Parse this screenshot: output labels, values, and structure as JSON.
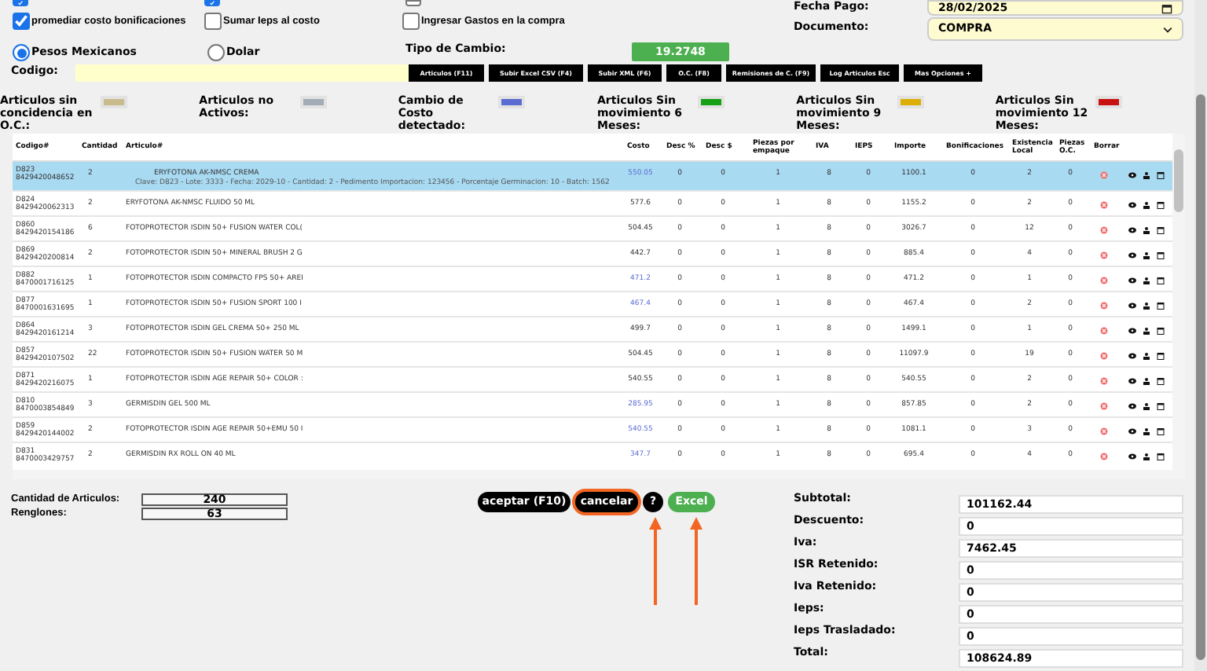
{
  "top_checkboxes": [
    {
      "checked": true
    },
    {
      "checked": true
    },
    {
      "checked": false
    }
  ],
  "fecha_pago": {
    "label": "Fecha Pago:",
    "value": "28/02/2025"
  },
  "options": [
    {
      "label": "promediar costo bonificaciones",
      "checked": true
    },
    {
      "label": "Sumar Ieps al costo",
      "checked": false
    },
    {
      "label": "Ingresar Gastos en la compra",
      "checked": false
    }
  ],
  "documento": {
    "label": "Documento:",
    "value": "COMPRA"
  },
  "currency": [
    {
      "label": "Pesos Mexicanos",
      "selected": true
    },
    {
      "label": "Dolar",
      "selected": false
    }
  ],
  "tipo_cambio": {
    "label": "Tipo de Cambio:",
    "value": "19.2748"
  },
  "codigo": {
    "label": "Codigo:"
  },
  "toolbar": [
    "Articulos (F11)",
    "Subir Excel CSV (F4)",
    "Subir XML (F6)",
    "O.C. (F8)",
    "Remisiones de C. (F9)",
    "Log Articulos Esc",
    "Mas Opciones +"
  ],
  "legend": [
    {
      "label": "Articulos sin concidencia en O.C.:",
      "color": "#c9bc8c"
    },
    {
      "label": "Articulos no Activos:",
      "color": "#a3abb7"
    },
    {
      "label": "Cambio de Costo detectado:",
      "color": "#5a6cd2"
    },
    {
      "label": "Articulos Sin movimiento 6 Meses:",
      "color": "#16a016"
    },
    {
      "label": "Articulos Sin movimiento 9 Meses:",
      "color": "#dcae06"
    },
    {
      "label": "Articulos Sin movimiento 12 Meses:",
      "color": "#c81212"
    }
  ],
  "table": {
    "columns": [
      "Codigo#",
      "Cantidad",
      "Articulo#",
      "Costo",
      "Desc %",
      "Desc $",
      "Piezas por empaque",
      "IVA",
      "IEPS",
      "Importe",
      "Bonificaciones",
      "Existencia Local",
      "Piezas O.C.",
      "Borrar"
    ],
    "rows": [
      {
        "selected": true,
        "cost_changed": true,
        "code": "D823",
        "barcode": "8429420048652",
        "qty": "2",
        "article": "ERYFOTONA AK-NMSC CREMA",
        "detail": "Clave: D823 - Lote: 3333 - Fecha: 2029-10 - Cantidad: 2 - Pedimento Importacion: 123456 - Porcentaje Germinacion: 10 - Batch: 1562",
        "cost": "550.05",
        "desc_pct": "0",
        "desc_amt": "0",
        "pieces": "1",
        "iva": "8",
        "ieps": "0",
        "importe": "1100.1",
        "bonif": "0",
        "stock": "2",
        "pieces_oc": "0"
      },
      {
        "selected": false,
        "cost_changed": false,
        "code": "D824",
        "barcode": "8429420062313",
        "qty": "2",
        "article": "ERYFOTONA AK-NMSC FLUIDO 50 ML",
        "cost": "577.6",
        "desc_pct": "0",
        "desc_amt": "0",
        "pieces": "1",
        "iva": "8",
        "ieps": "0",
        "importe": "1155.2",
        "bonif": "0",
        "stock": "2",
        "pieces_oc": "0"
      },
      {
        "selected": false,
        "cost_changed": false,
        "code": "D860",
        "barcode": "8429420154186",
        "qty": "6",
        "article": "FOTOPROTECTOR ISDIN 50+ FUSION WATER COL(",
        "cost": "504.45",
        "desc_pct": "0",
        "desc_amt": "0",
        "pieces": "1",
        "iva": "8",
        "ieps": "0",
        "importe": "3026.7",
        "bonif": "0",
        "stock": "12",
        "pieces_oc": "0"
      },
      {
        "selected": false,
        "cost_changed": false,
        "code": "D869",
        "barcode": "8429420200814",
        "qty": "2",
        "article": "FOTOPROTECTOR ISDIN 50+ MINERAL BRUSH 2 G",
        "cost": "442.7",
        "desc_pct": "0",
        "desc_amt": "0",
        "pieces": "1",
        "iva": "8",
        "ieps": "0",
        "importe": "885.4",
        "bonif": "0",
        "stock": "4",
        "pieces_oc": "0"
      },
      {
        "selected": false,
        "cost_changed": true,
        "code": "D882",
        "barcode": "8470001716125",
        "qty": "1",
        "article": "FOTOPROTECTOR ISDIN COMPACTO FPS 50+ AREI",
        "cost": "471.2",
        "desc_pct": "0",
        "desc_amt": "0",
        "pieces": "1",
        "iva": "8",
        "ieps": "0",
        "importe": "471.2",
        "bonif": "0",
        "stock": "1",
        "pieces_oc": "0"
      },
      {
        "selected": false,
        "cost_changed": true,
        "code": "D877",
        "barcode": "8470001631695",
        "qty": "1",
        "article": "FOTOPROTECTOR ISDIN 50+ FUSION SPORT 100 I",
        "cost": "467.4",
        "desc_pct": "0",
        "desc_amt": "0",
        "pieces": "1",
        "iva": "8",
        "ieps": "0",
        "importe": "467.4",
        "bonif": "0",
        "stock": "2",
        "pieces_oc": "0"
      },
      {
        "selected": false,
        "cost_changed": false,
        "code": "D864",
        "barcode": "8429420161214",
        "qty": "3",
        "article": "FOTOPROTECTOR ISDIN GEL CREMA 50+ 250 ML",
        "cost": "499.7",
        "desc_pct": "0",
        "desc_amt": "0",
        "pieces": "1",
        "iva": "8",
        "ieps": "0",
        "importe": "1499.1",
        "bonif": "0",
        "stock": "1",
        "pieces_oc": "0"
      },
      {
        "selected": false,
        "cost_changed": false,
        "code": "D857",
        "barcode": "8429420107502",
        "qty": "22",
        "article": "FOTOPROTECTOR ISDIN 50+ FUSION WATER 50 M",
        "cost": "504.45",
        "desc_pct": "0",
        "desc_amt": "0",
        "pieces": "1",
        "iva": "8",
        "ieps": "0",
        "importe": "11097.9",
        "bonif": "0",
        "stock": "19",
        "pieces_oc": "0"
      },
      {
        "selected": false,
        "cost_changed": false,
        "code": "D871",
        "barcode": "8429420216075",
        "qty": "1",
        "article": "FOTOPROTECTOR ISDIN AGE REPAIR 50+ COLOR :",
        "cost": "540.55",
        "desc_pct": "0",
        "desc_amt": "0",
        "pieces": "1",
        "iva": "8",
        "ieps": "0",
        "importe": "540.55",
        "bonif": "0",
        "stock": "2",
        "pieces_oc": "0"
      },
      {
        "selected": false,
        "cost_changed": true,
        "code": "D810",
        "barcode": "8470003854849",
        "qty": "3",
        "article": "GERMISDIN GEL 500 ML",
        "cost": "285.95",
        "desc_pct": "0",
        "desc_amt": "0",
        "pieces": "1",
        "iva": "8",
        "ieps": "0",
        "importe": "857.85",
        "bonif": "0",
        "stock": "2",
        "pieces_oc": "0"
      },
      {
        "selected": false,
        "cost_changed": true,
        "code": "D859",
        "barcode": "8429420144002",
        "qty": "2",
        "article": "FOTOPROTECTOR ISDIN AGE REPAIR 50+EMU 50 I",
        "cost": "540.55",
        "desc_pct": "0",
        "desc_amt": "0",
        "pieces": "1",
        "iva": "8",
        "ieps": "0",
        "importe": "1081.1",
        "bonif": "0",
        "stock": "3",
        "pieces_oc": "0"
      },
      {
        "selected": false,
        "cost_changed": true,
        "code": "D831",
        "barcode": "8470003429757",
        "qty": "2",
        "article": "GERMISDIN RX ROLL ON 40 ML",
        "cost": "347.7",
        "desc_pct": "0",
        "desc_amt": "0",
        "pieces": "1",
        "iva": "8",
        "ieps": "0",
        "importe": "695.4",
        "bonif": "0",
        "stock": "4",
        "pieces_oc": "0"
      }
    ]
  },
  "counts": [
    {
      "label": "Cantidad de Articulos:",
      "value": "240"
    },
    {
      "label": "Renglones:",
      "value": "63"
    }
  ],
  "actions": [
    {
      "label": "aceptar (F10)",
      "kind": "dark",
      "highlighted": false
    },
    {
      "label": "cancelar",
      "kind": "dark",
      "highlighted": true
    },
    {
      "label": "?",
      "kind": "dark",
      "highlighted": false
    },
    {
      "label": "Excel",
      "kind": "green",
      "highlighted": false
    }
  ],
  "annotations": [
    {
      "kind": "arrow"
    },
    {
      "kind": "arrow"
    }
  ],
  "totals": [
    {
      "label": "Subtotal:",
      "value": "101162.44"
    },
    {
      "label": "Descuento:",
      "value": "0"
    },
    {
      "label": "Iva:",
      "value": "7462.45"
    },
    {
      "label": "ISR Retenido:",
      "value": "0"
    },
    {
      "label": "Iva Retenido:",
      "value": "0"
    },
    {
      "label": "Ieps:",
      "value": "0"
    },
    {
      "label": "Ieps Trasladado:",
      "value": "0"
    },
    {
      "label": "Total:",
      "value": "108624.89"
    }
  ]
}
